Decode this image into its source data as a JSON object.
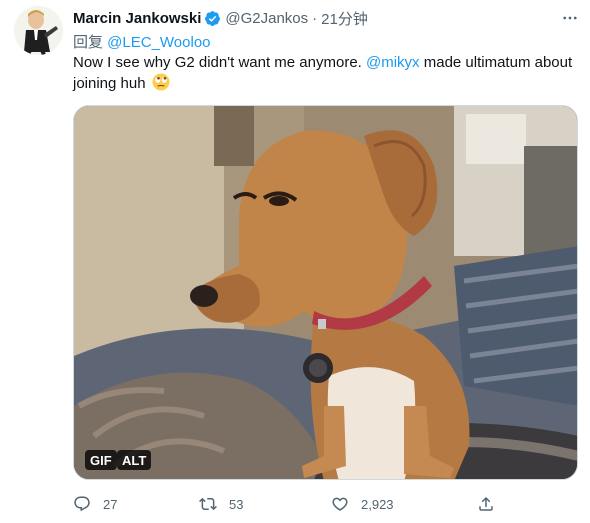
{
  "author": {
    "name": "Marcin Jankowski",
    "handle": "@G2Jankos",
    "separator": "·",
    "time": "21分钟",
    "verified": true
  },
  "reply": {
    "prefix": "回复 ",
    "mention": "@LEC_Wooloo"
  },
  "tweet": {
    "text_part1": "Now I see why G2 didn't want me anymore. ",
    "mention": "@mikyx",
    "text_part2": " made ultimatum about joining huh ",
    "emoji": "face-with-rolling-eyes-emoji"
  },
  "media": {
    "type": "gif",
    "gif_label": "GIF",
    "alt_label": "ALT"
  },
  "actions": {
    "replies": "27",
    "retweets": "53",
    "likes": "2,923"
  },
  "colors": {
    "accent": "#1d9bf0",
    "secondary_text": "#536471",
    "primary_text": "#0f1419"
  },
  "icons": [
    "verified-badge-icon",
    "more-options-icon",
    "reply-icon",
    "retweet-icon",
    "like-icon",
    "share-icon"
  ]
}
